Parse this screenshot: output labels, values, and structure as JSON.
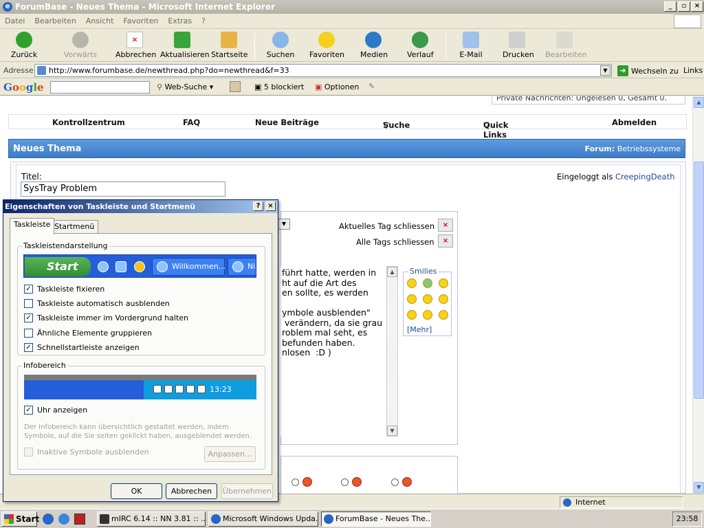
{
  "window": {
    "title": "ForumBase - Neues Thema - Microsoft Internet Explorer"
  },
  "menu": [
    "Datei",
    "Bearbeiten",
    "Ansicht",
    "Favoriten",
    "Extras",
    "?"
  ],
  "toolbar": {
    "back": "Zurück",
    "forward": "Vorwärts",
    "stop": "Abbrechen",
    "refresh": "Aktualisieren",
    "home": "Startseite",
    "search": "Suchen",
    "favorites": "Favoriten",
    "media": "Medien",
    "history": "Verlauf",
    "mail": "E-Mail",
    "print": "Drucken",
    "edit": "Bearbeiten"
  },
  "address": {
    "label": "Adresse",
    "url": "http://www.forumbase.de/newthread.php?do=newthread&f=33",
    "go": "Wechseln zu",
    "links": "Links"
  },
  "google": {
    "logo": "Google",
    "web_search": "Web-Suche",
    "blocked": "5 blockiert",
    "options": "Optionen"
  },
  "forum": {
    "pm_line": "Private Nachrichten: Ungelesen 0, Gesamt 0.",
    "nav": [
      "Kontrollzentrum",
      "FAQ",
      "Neue Beiträge",
      "Suche",
      "Quick Links",
      "Abmelden"
    ],
    "header_title": "Neues Thema",
    "forum_label": "Forum:",
    "forum_name": "Betriebssysteme",
    "title_label": "Titel:",
    "title_value": "SysTray Problem",
    "logged_in_label": "Eingeloggt als",
    "username": "CreepingDeath",
    "close_tag": "Aktuelles Tag schliessen",
    "close_all_tags": "Alle Tags schliessen",
    "message_text": "führt hatte, werden in\nht auf die Art des\nen sollte, es werden\n\nymbole ausblenden\"\n verändern, da sie grau\nroblem mal seht, es\nbefunden haben.\nnlosen  :D )",
    "smilies_label": "Smilies",
    "more_label": "[Mehr]"
  },
  "dialog": {
    "title": "Eigenschaften von Taskleiste und Startmenü",
    "tabs": [
      "Taskleiste",
      "Startmenü"
    ],
    "group1": "Taskleistendarstellung",
    "start_label": "Start",
    "task_welcome": "Willkommen...",
    "task_partial": "Nin",
    "options": [
      {
        "label": "Taskleiste fixieren",
        "checked": true
      },
      {
        "label": "Taskleiste automatisch ausblenden",
        "checked": false
      },
      {
        "label": "Taskleiste immer im Vordergrund halten",
        "checked": true
      },
      {
        "label": "Ähnliche Elemente gruppieren",
        "checked": false
      },
      {
        "label": "Schnellstartleiste anzeigen",
        "checked": true
      }
    ],
    "group2": "Infobereich",
    "tray_time": "13:23",
    "clock_option": "Uhr anzeigen",
    "info_text": "Der Infobereich kann übersichtlich gestaltet werden, indem Symbole, auf die Sie selten geklickt haben, ausgeblendet werden.",
    "hide_inactive": "Inaktive Symbole ausblenden",
    "customize": "Anpassen...",
    "ok": "OK",
    "cancel": "Abbrechen",
    "apply": "Übernehmen"
  },
  "status": {
    "zone": "Internet"
  },
  "taskbar": {
    "start": "Start",
    "tasks": [
      "mIRC 6.14 :: NN 3.81 :: ...",
      "Microsoft Windows Upda...",
      "ForumBase - Neues The..."
    ],
    "clock": "23:58"
  },
  "colors": {
    "header_blue": "#4a88d4",
    "link": "#1f4b8f",
    "xp_blue": "#245edb"
  }
}
